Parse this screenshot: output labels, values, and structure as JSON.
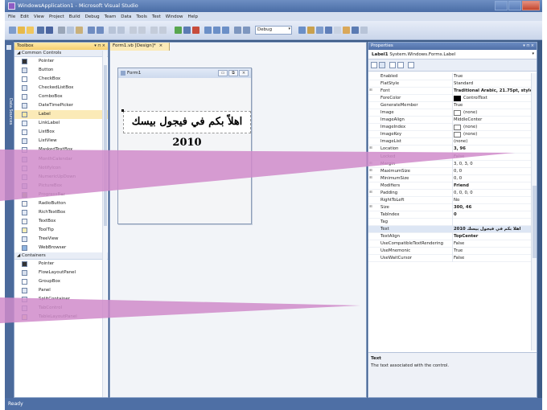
{
  "window": {
    "title": "WindowsApplication1 - Microsoft Visual Studio"
  },
  "menu": [
    "File",
    "Edit",
    "View",
    "Project",
    "Build",
    "Debug",
    "Team",
    "Data",
    "Tools",
    "Test",
    "Window",
    "Help"
  ],
  "toolbar": {
    "configuration": "Debug"
  },
  "side_strip": {
    "label": "Data Sources"
  },
  "toolbox": {
    "title": "Toolbox",
    "header_controls": "▾ ⊓ ×",
    "group_common": "Common Controls",
    "common_items": [
      "Pointer",
      "Button",
      "CheckBox",
      "CheckedListBox",
      "ComboBox",
      "DateTimePicker",
      "Label",
      "LinkLabel",
      "ListBox",
      "ListView",
      "MaskedTextBox",
      "MonthCalendar",
      "NotifyIcon",
      "NumericUpDown",
      "PictureBox",
      "ProgressBar",
      "RadioButton",
      "RichTextBox",
      "TextBox",
      "ToolTip",
      "TreeView",
      "WebBrowser"
    ],
    "group_containers": "Containers",
    "container_items": [
      "Pointer",
      "FlowLayoutPanel",
      "GroupBox",
      "Panel",
      "SplitContainer",
      "TabControl",
      "TableLayoutPanel"
    ]
  },
  "designer": {
    "tab_label": "Form1.vb [Design]*",
    "tab_close": "×",
    "form_title": "Form1",
    "form_buttons": [
      "▭",
      "⧉",
      "×"
    ],
    "label_text": "اهلاً بكم في فيجول بيسك 2010"
  },
  "properties": {
    "title": "Properties",
    "header_controls": "▾ ⊓ ×",
    "object": "Label1",
    "object_type": "System.Windows.Forms.Label",
    "rows": [
      {
        "name": "Enabled",
        "value": "True"
      },
      {
        "name": "FlatStyle",
        "value": "Standard"
      },
      {
        "name": "Font",
        "value": "Traditional Arabic, 21.75pt, style",
        "expandable": true,
        "bold": true
      },
      {
        "name": "ForeColor",
        "value": "ControlText",
        "swatch": "black"
      },
      {
        "name": "GenerateMember",
        "value": "True"
      },
      {
        "name": "Image",
        "value": "(none)",
        "swatch": "white"
      },
      {
        "name": "ImageAlign",
        "value": "MiddleCenter"
      },
      {
        "name": "ImageIndex",
        "value": "(none)",
        "swatch": "white"
      },
      {
        "name": "ImageKey",
        "value": "(none)",
        "swatch": "white"
      },
      {
        "name": "ImageList",
        "value": "(none)"
      },
      {
        "name": "Location",
        "value": "3, 96",
        "expandable": true,
        "bold": true
      },
      {
        "name": "Locked",
        "value": "False"
      },
      {
        "name": "Margin",
        "value": "3, 0, 3, 0",
        "expandable": true
      },
      {
        "name": "MaximumSize",
        "value": "0, 0",
        "expandable": true
      },
      {
        "name": "MinimumSize",
        "value": "0, 0",
        "expandable": true
      },
      {
        "name": "Modifiers",
        "value": "Friend",
        "bold": true
      },
      {
        "name": "Padding",
        "value": "0, 0, 0, 0",
        "expandable": true
      },
      {
        "name": "RightToLeft",
        "value": "No"
      },
      {
        "name": "Size",
        "value": "300, 46",
        "expandable": true,
        "bold": true
      },
      {
        "name": "TabIndex",
        "value": "0",
        "bold": true
      },
      {
        "name": "Tag",
        "value": ""
      },
      {
        "name": "Text",
        "value": "اهلاً بكم في فيجول بيسك 2010",
        "bold": true
      },
      {
        "name": "TextAlign",
        "value": "TopCenter",
        "bold": true
      },
      {
        "name": "UseCompatibleTextRendering",
        "value": "False"
      },
      {
        "name": "UseMnemonic",
        "value": "True"
      },
      {
        "name": "UseWaitCursor",
        "value": "False"
      }
    ],
    "description_title": "Text",
    "description_text": "The text associated with the control."
  },
  "status": {
    "text": "Ready"
  },
  "colors": {
    "callout": "#cf8cc8",
    "title_bar": "#4a6da6",
    "tab_active": "#fbeab7"
  }
}
